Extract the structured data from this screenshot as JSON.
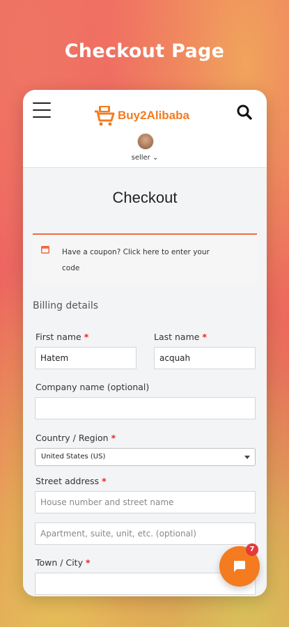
{
  "promo": {
    "title": "Checkout Page"
  },
  "header": {
    "brand": "Buy2Alibaba",
    "user_label": "seller",
    "icons": {
      "menu": "hamburger-icon",
      "search": "search-icon",
      "cart": "cart-logo-icon"
    }
  },
  "page": {
    "title": "Checkout"
  },
  "coupon": {
    "text": "Have a coupon? ",
    "link": "Click here to enter your",
    "link_cont": "code"
  },
  "billing": {
    "heading": "Billing details",
    "first_name": {
      "label": "First name",
      "value": "Hatem"
    },
    "last_name": {
      "label": "Last name",
      "value": "acquah"
    },
    "company": {
      "label": "Company name (optional)",
      "value": ""
    },
    "country": {
      "label": "Country / Region",
      "value": "United States (US)"
    },
    "street": {
      "label": "Street address",
      "placeholder1": "House number and street name",
      "placeholder2": "Apartment, suite, unit, etc. (optional)"
    },
    "city": {
      "label": "Town / City",
      "value": ""
    },
    "required_mark": "*"
  },
  "chat": {
    "badge": "7"
  },
  "colors": {
    "accent": "#f47b20",
    "required": "#e22222",
    "coupon_border": "#ee6a3d"
  }
}
